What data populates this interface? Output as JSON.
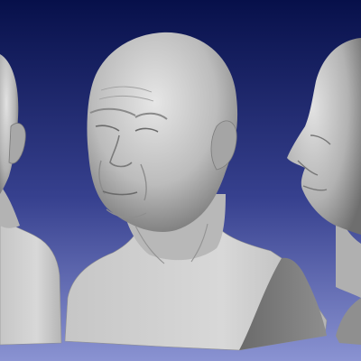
{
  "scene": {
    "description_visible_text": "",
    "colors": {
      "background_top": "#07104a",
      "background_bottom": "#8a93d2",
      "mesh_light": "#dcdcdc",
      "mesh_mid": "#a9a9a9",
      "mesh_dark": "#5e5e5e"
    }
  }
}
